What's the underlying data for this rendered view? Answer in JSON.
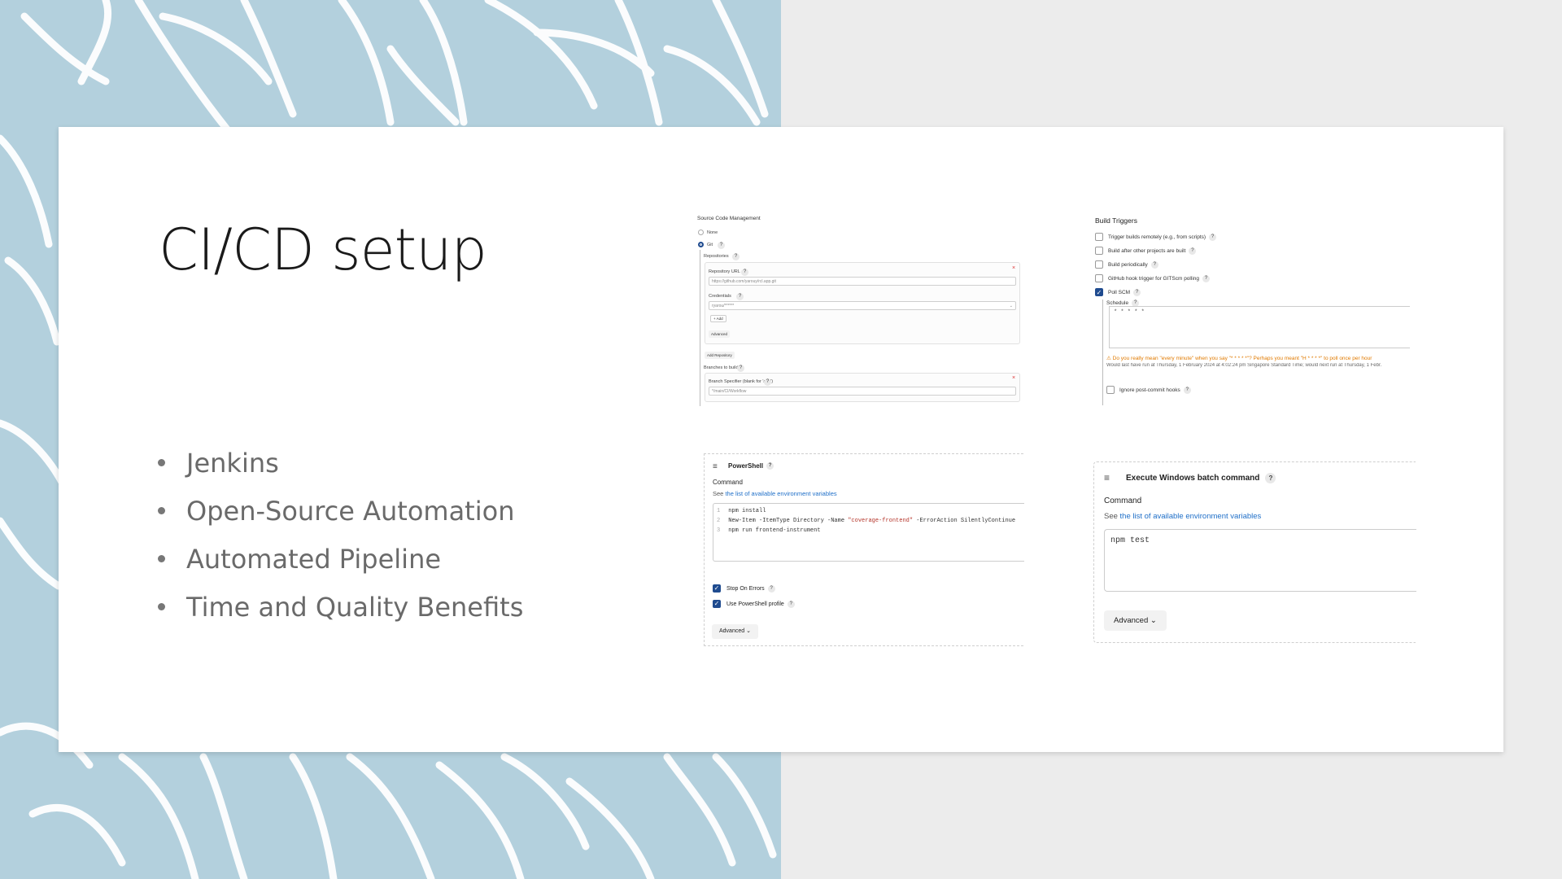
{
  "slide": {
    "title": "CI/CD setup",
    "bullets": [
      "Jenkins",
      "Open-Source Automation",
      "Automated Pipeline",
      "Time and Quality Benefits"
    ]
  },
  "scm_panel": {
    "title": "Source Code Management",
    "option_none": "None",
    "option_git": "Git",
    "repositories_label": "Repositories",
    "repo_url_label": "Repository URL",
    "repo_url_value": "https://github.com/yarouy/rcl.app.git",
    "credentials_label": "Credentials",
    "credentials_value": "ryarou/******",
    "add_button": "+ Add",
    "advanced_button": "Advanced",
    "add_repository_button": "Add Repository",
    "branches_label": "Branches to build",
    "branch_specifier_label": "Branch Specifier (blank for 'any')",
    "branch_specifier_value": "*/main/CI/Workflow"
  },
  "build_triggers": {
    "title": "Build Triggers",
    "options": [
      {
        "label": "Trigger builds remotely (e.g., from scripts)",
        "checked": false
      },
      {
        "label": "Build after other projects are built",
        "checked": false
      },
      {
        "label": "Build periodically",
        "checked": false
      },
      {
        "label": "GitHub hook trigger for GITScm polling",
        "checked": false
      },
      {
        "label": "Poll SCM",
        "checked": true
      }
    ],
    "schedule_label": "Schedule",
    "schedule_value": "* * * * *",
    "warning": "Do you really mean \"every minute\" when you say \"* * * * *\"? Perhaps you meant \"H * * * *\" to poll once per hour",
    "note": "Would last have run at Thursday, 1 February 2024 at 4:02:24 pm Singapore Standard Time; would next run at Thursday, 1 Febr.",
    "ignore_hooks_label": "Ignore post-commit hooks"
  },
  "powershell": {
    "title": "PowerShell",
    "command_label": "Command",
    "see_prefix": "See",
    "see_link": "the list of available environment variables",
    "code_lines": [
      {
        "n": "1",
        "pre": "npm install",
        "str": "",
        "post": ""
      },
      {
        "n": "2",
        "pre": "New-Item -ItemType Directory -Name ",
        "str": "\"coverage-frontend\"",
        "post": " -ErrorAction SilentlyContinue"
      },
      {
        "n": "3",
        "pre": "npm run frontend-instrument",
        "str": "",
        "post": ""
      }
    ],
    "stop_on_errors": "Stop On Errors",
    "use_profile": "Use PowerShell profile",
    "advanced_button": "Advanced"
  },
  "batch": {
    "title": "Execute Windows batch command",
    "command_label": "Command",
    "see_prefix": "See",
    "see_link": "the list of available environment variables",
    "code": "npm test",
    "advanced_button": "Advanced"
  },
  "glyphs": {
    "question": "?",
    "check": "✓",
    "hamburger": "≡",
    "chevron": "⌄",
    "close": "×",
    "warning": "⚠"
  },
  "colors": {
    "leaf_background": "#b3d0dd",
    "accent_blue": "#1f4b8f",
    "link_blue": "#1f6fc8",
    "warning_orange": "#e07a00"
  }
}
